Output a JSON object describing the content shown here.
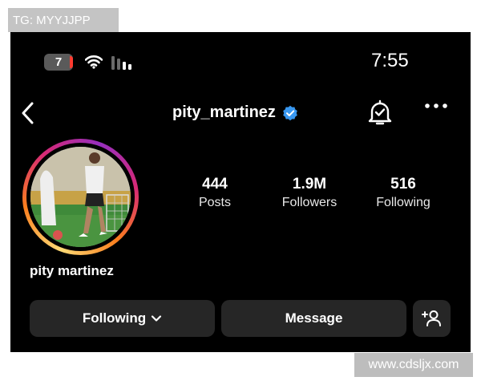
{
  "watermarks": {
    "top_left": "TG: MYYJJPP",
    "bottom_right": "www.cdsljx.com"
  },
  "status_bar": {
    "battery_level": "7",
    "time": "7:55",
    "icons": [
      "battery-icon",
      "wifi-icon",
      "signal-icon"
    ]
  },
  "header": {
    "username": "pity_martinez",
    "verified": true,
    "icons": [
      "back-chevron-icon",
      "verified-badge-icon",
      "notification-bell-icon",
      "more-options-icon"
    ]
  },
  "profile": {
    "display_name": "pity martinez",
    "stats": {
      "posts": {
        "value": "444",
        "label": "Posts"
      },
      "followers": {
        "value": "1.9M",
        "label": "Followers"
      },
      "following": {
        "value": "516",
        "label": "Following"
      }
    }
  },
  "actions": {
    "following_label": "Following",
    "message_label": "Message",
    "icons": [
      "chevron-down-icon",
      "add-person-icon"
    ]
  },
  "colors": {
    "background": "#000000",
    "button_bg": "#262626",
    "verified_blue": "#3897f0",
    "story_ring": [
      "#feda75",
      "#fa7e1e",
      "#d62976",
      "#962fbf"
    ]
  }
}
